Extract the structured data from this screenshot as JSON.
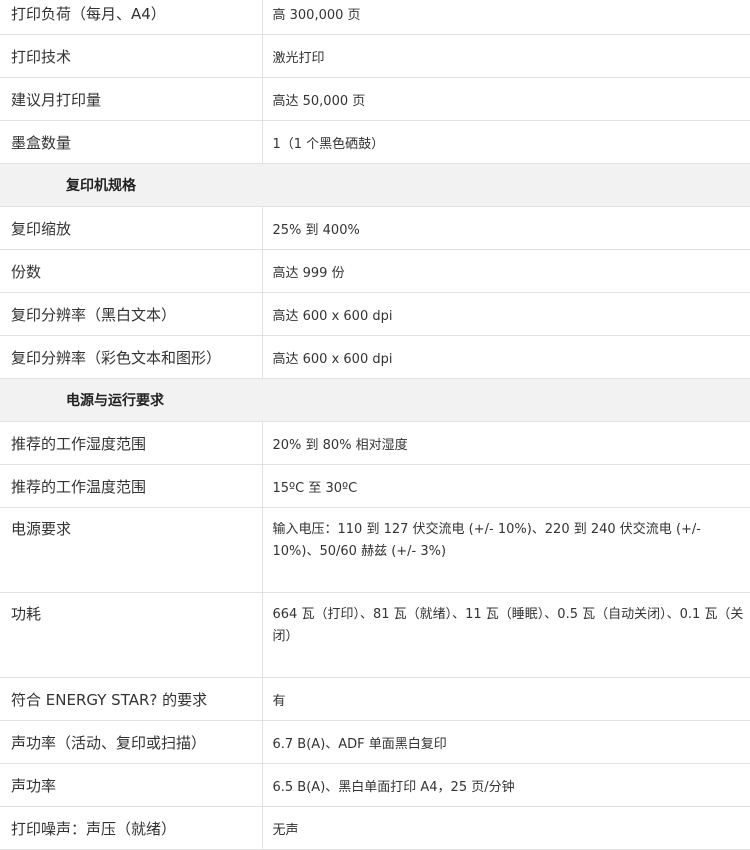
{
  "rows": [
    {
      "label": "打印负荷（每月、A4）",
      "value": "高 300,000 页"
    },
    {
      "label": "打印技术",
      "value": "激光打印"
    },
    {
      "label": "建议月打印量",
      "value": "高达 50,000 页"
    },
    {
      "label": "墨盒数量",
      "value": "1（1 个黑色硒鼓）"
    },
    {
      "section": "复印机规格"
    },
    {
      "label": "复印缩放",
      "value": "25% 到 400%"
    },
    {
      "label": "份数",
      "value": "高达 999 份"
    },
    {
      "label": "复印分辨率（黑白文本）",
      "value": "高达 600 x 600 dpi"
    },
    {
      "label": "复印分辨率（彩色文本和图形）",
      "value": "高达 600 x 600 dpi"
    },
    {
      "section": "电源与运行要求"
    },
    {
      "label": "推荐的工作湿度范围",
      "value": "20% 到 80% 相对湿度"
    },
    {
      "label": "推荐的工作温度范围",
      "value": "15ºC 至 30ºC"
    },
    {
      "label": "电源要求",
      "value": "输入电压：110 到 127 伏交流电 (+/- 10%)、220 到 240 伏交流电 (+/- 10%)、50/60 赫兹 (+/- 3%)",
      "tall": true
    },
    {
      "label": "功耗",
      "value": "664 瓦（打印）、81 瓦（就绪）、11 瓦（睡眠）、0.5 瓦（自动关闭）、0.1 瓦（关闭）",
      "tall": true
    },
    {
      "label": "符合 ENERGY STAR? 的要求",
      "value": "有"
    },
    {
      "label": "声功率（活动、复印或扫描）",
      "value": "6.7 B(A)、ADF 单面黑白复印"
    },
    {
      "label": "声功率",
      "value": "6.5 B(A)、黑白单面打印 A4，25 页/分钟"
    },
    {
      "label": "打印噪声：声压（就绪）",
      "value": "无声"
    }
  ]
}
